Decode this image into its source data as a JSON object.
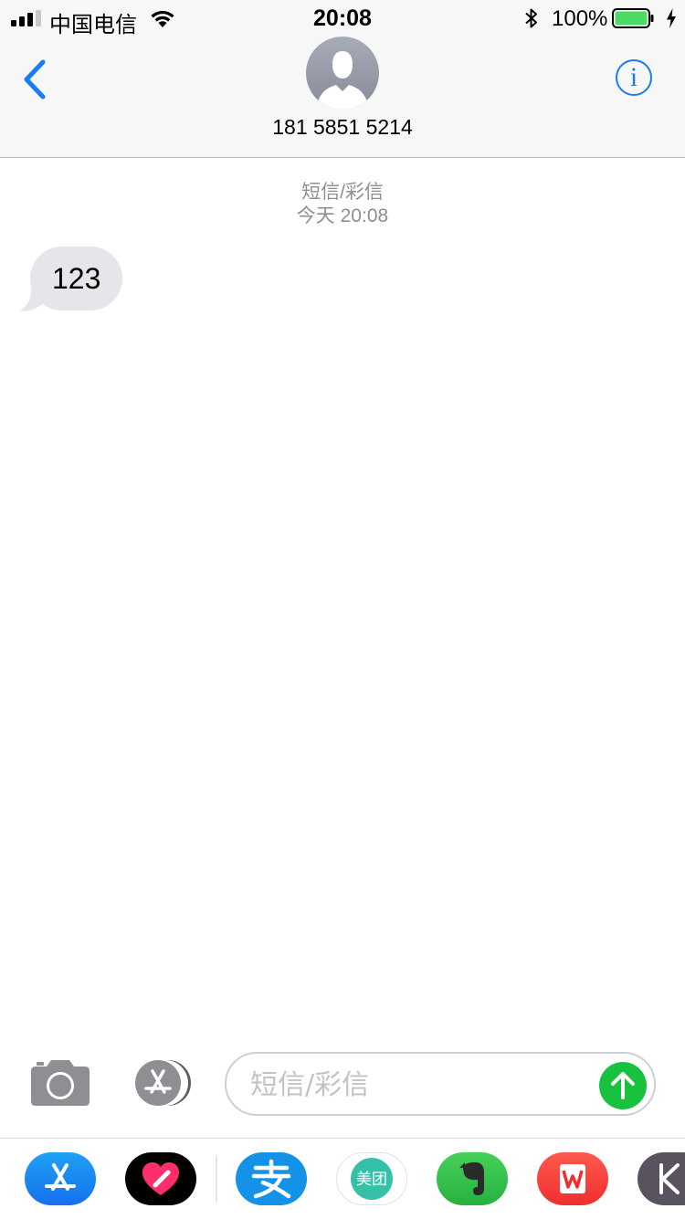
{
  "status_bar": {
    "carrier": "中国电信",
    "time": "20:08",
    "battery_percent": "100%"
  },
  "nav": {
    "contact_name": "181 5851 5214",
    "info_label": "i"
  },
  "thread": {
    "message_type": "短信/彩信",
    "timestamp": "今天 20:08",
    "messages": [
      {
        "direction": "incoming",
        "text": "123"
      }
    ]
  },
  "compose": {
    "placeholder": "短信/彩信"
  },
  "app_drawer": {
    "apps": [
      {
        "name": "App Store",
        "icon": "app-store-icon"
      },
      {
        "name": "Digital Touch",
        "icon": "digital-touch-icon"
      },
      {
        "name": "Alipay",
        "icon": "alipay-icon"
      },
      {
        "name": "Meituan",
        "icon": "meituan-icon",
        "label": "美团"
      },
      {
        "name": "Evernote",
        "icon": "evernote-icon"
      },
      {
        "name": "WPS",
        "icon": "wps-icon"
      },
      {
        "name": "K",
        "icon": "k-app-icon"
      }
    ]
  },
  "colors": {
    "accent_blue": "#1a7cf5",
    "send_green": "#18c23f",
    "bubble_gray": "#e5e5ea",
    "meta_gray": "#8e8e93"
  }
}
